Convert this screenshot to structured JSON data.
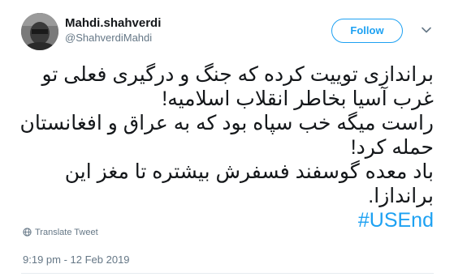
{
  "author": {
    "name": "Mahdi.shahverdi",
    "handle": "@ShahverdiMahdi"
  },
  "actions": {
    "follow_label": "Follow",
    "menu_icon": "chevron-down-icon"
  },
  "tweet": {
    "lines": [
      "براندازی توییت کرده که جنگ و درگیری فعلی تو",
      "غرب آسیا بخاطر انقلاب اسلامیه!",
      "راست میگه خب سپاه بود که به عراق و افغانستان",
      "حمله کرد!",
      "باد معده گوسفند فسفرش بیشتره تا مغز این",
      "براندازا."
    ],
    "hashtag": "#USEnd"
  },
  "translate_label": "Translate Tweet",
  "timestamp": "9:19 pm - 12 Feb 2019",
  "colors": {
    "accent": "#1da1f2",
    "muted": "#657786",
    "text": "#14171a"
  }
}
